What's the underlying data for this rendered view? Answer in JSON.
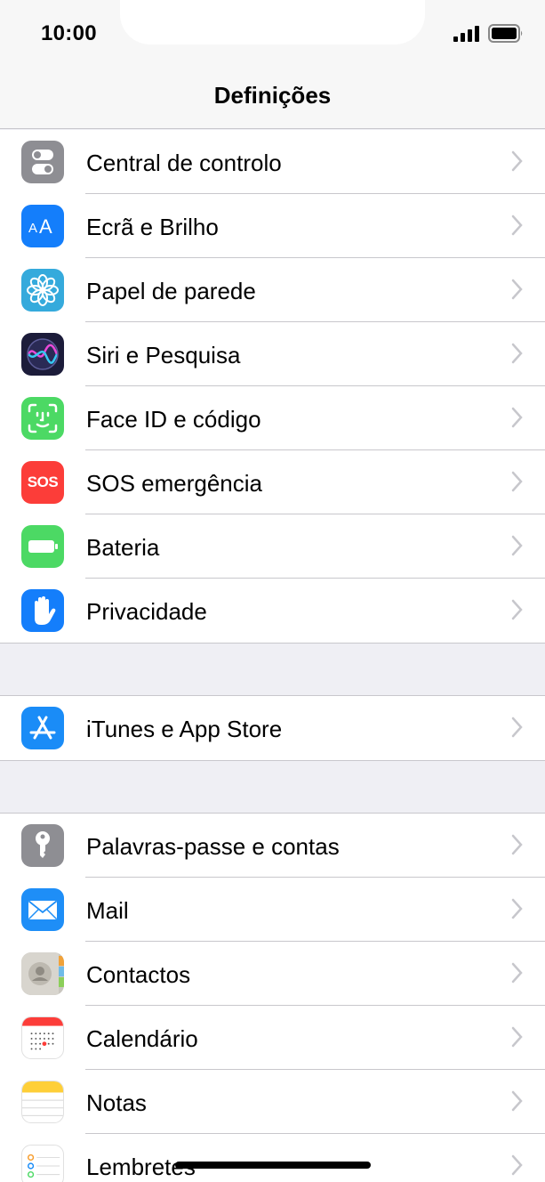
{
  "status_bar": {
    "time": "10:00"
  },
  "nav": {
    "title": "Definições"
  },
  "groups": [
    {
      "items": [
        {
          "label": "Central de controlo",
          "icon": "toggles-icon",
          "color": "#8e8e93"
        },
        {
          "label": "Ecrã e Brilho",
          "icon": "text-size-icon",
          "color": "#147efb"
        },
        {
          "label": "Papel de parede",
          "icon": "flower-icon",
          "color": "#35aadc"
        },
        {
          "label": "Siri e Pesquisa",
          "icon": "siri-icon",
          "color": "#1c1c3a"
        },
        {
          "label": "Face ID e código",
          "icon": "face-id-icon",
          "color": "#4cd964"
        },
        {
          "label": "SOS emergência",
          "icon": "sos-icon",
          "color": "#fc3d39",
          "icon_text": "SOS"
        },
        {
          "label": "Bateria",
          "icon": "battery-icon",
          "color": "#4cd964"
        },
        {
          "label": "Privacidade",
          "icon": "hand-icon",
          "color": "#147efb"
        }
      ]
    },
    {
      "items": [
        {
          "label": "iTunes e App Store",
          "icon": "app-store-icon",
          "color": "#1a8cf7"
        }
      ]
    },
    {
      "items": [
        {
          "label": "Palavras-passe e contas",
          "icon": "key-icon",
          "color": "#8e8e93"
        },
        {
          "label": "Mail",
          "icon": "mail-icon",
          "color": "#1e8ef7"
        },
        {
          "label": "Contactos",
          "icon": "contacts-icon",
          "color": "#c9c6bf"
        },
        {
          "label": "Calendário",
          "icon": "calendar-icon",
          "color": "#ffffff"
        },
        {
          "label": "Notas",
          "icon": "notes-icon",
          "color": "#ffffff"
        },
        {
          "label": "Lembretes",
          "icon": "reminders-icon",
          "color": "#ffffff"
        }
      ]
    }
  ]
}
